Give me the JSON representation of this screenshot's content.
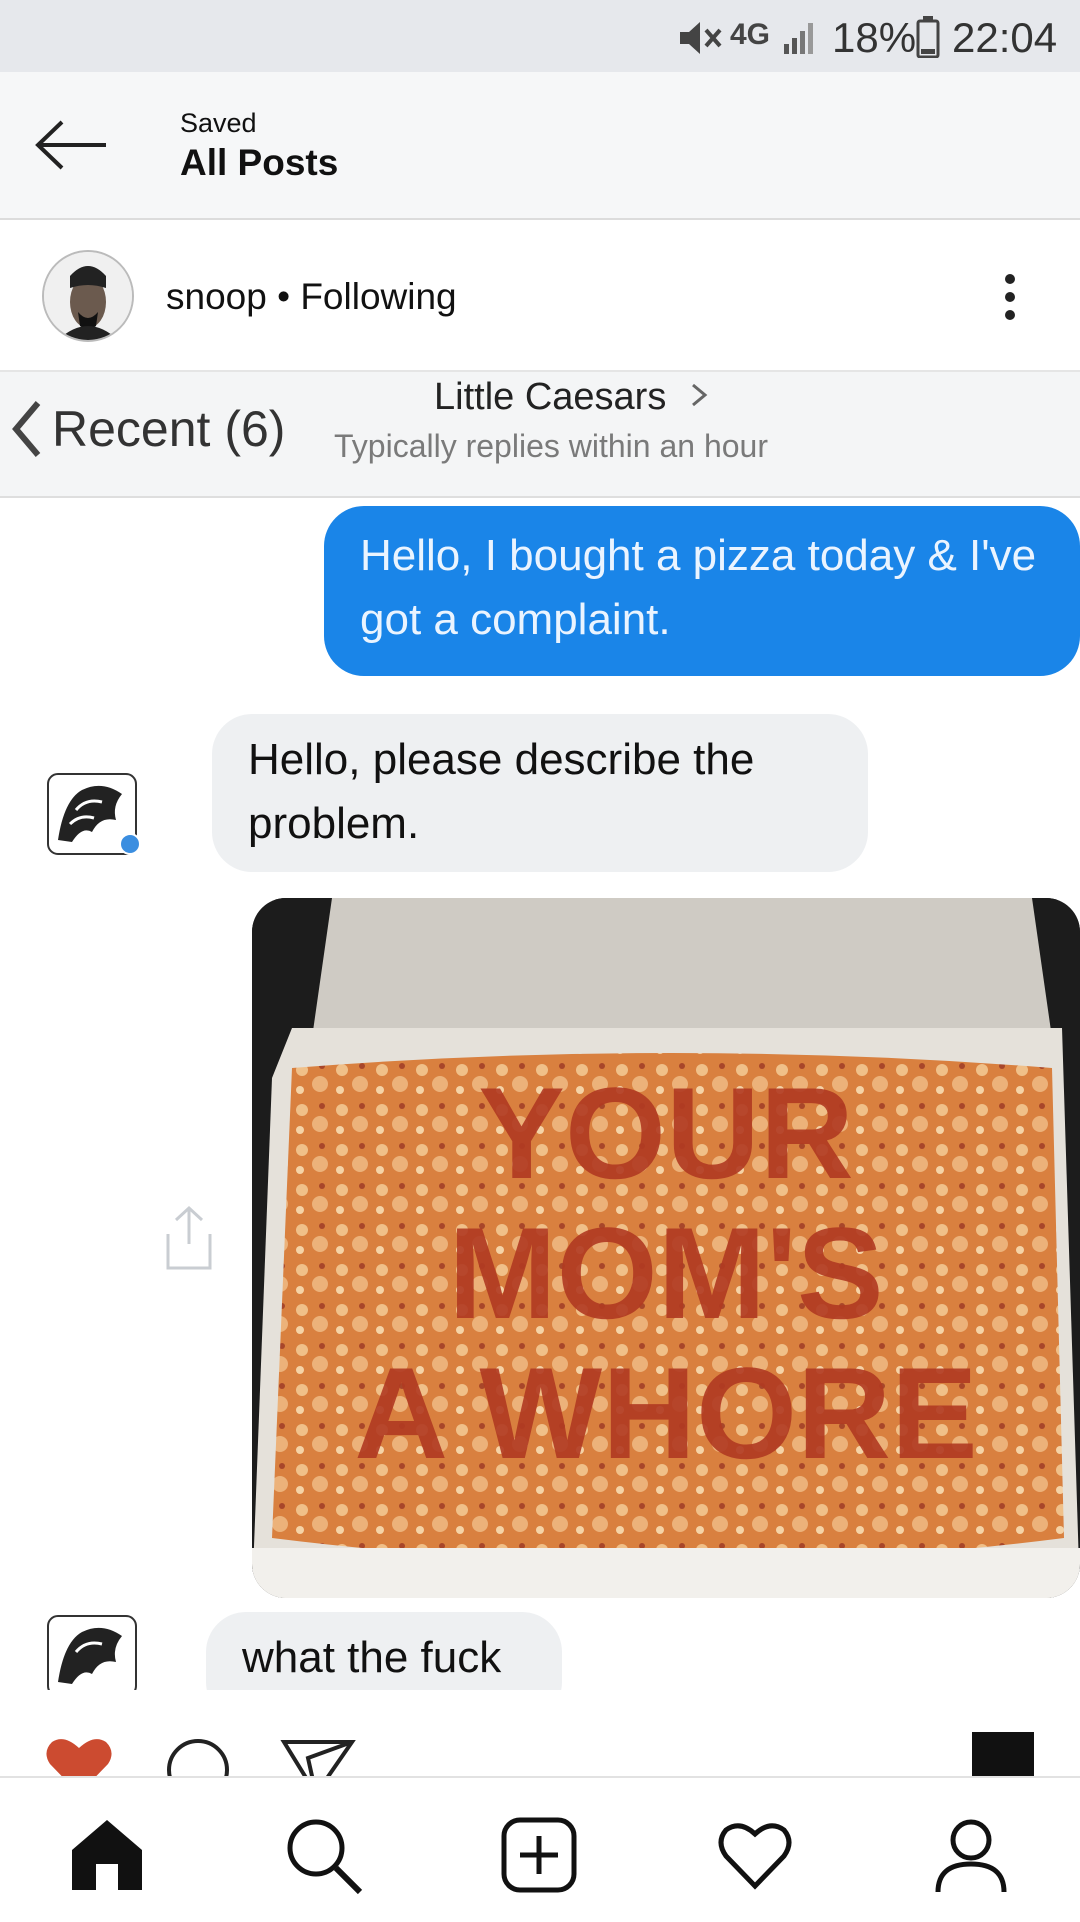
{
  "status_bar": {
    "network": "4G",
    "battery": "18%",
    "time": "22:04",
    "icons": [
      "mute-icon",
      "4g-lte-icon",
      "signal-icon",
      "battery-icon"
    ]
  },
  "header": {
    "back_icon": "arrow-left-icon",
    "subtitle": "Saved",
    "title": "All Posts"
  },
  "post": {
    "username": "snoop",
    "separator": "•",
    "follow_state": "Following",
    "label": "snoop • Following",
    "more_icon": "vertical-dots-icon"
  },
  "screenshot": {
    "nav_back_label": "Recent (6)",
    "contact_name": "Little Caesars",
    "contact_status": "Typically replies within an hour",
    "messages": [
      {
        "from": "user",
        "text": "Hello, I bought a pizza today & I've got a complaint."
      },
      {
        "from": "business",
        "text": "Hello, please describe the problem."
      },
      {
        "from": "business",
        "type": "photo",
        "text": "YOUR MOM'S A WHORE"
      },
      {
        "from": "business",
        "text": "what the fuck"
      }
    ],
    "share_icon": "share-icon"
  },
  "action_bar": {
    "icons": [
      "heart-filled-icon",
      "comment-icon",
      "send-icon",
      "bookmark-icon"
    ],
    "like_color": "#cc4b30"
  },
  "bottom_nav": {
    "items": [
      "home-icon",
      "search-icon",
      "add-post-icon",
      "activity-heart-icon",
      "profile-icon"
    ]
  },
  "colors": {
    "user_bubble": "#1a85e8",
    "other_bubble": "#eef0f2",
    "status_bar_bg": "#e6e8ec"
  }
}
